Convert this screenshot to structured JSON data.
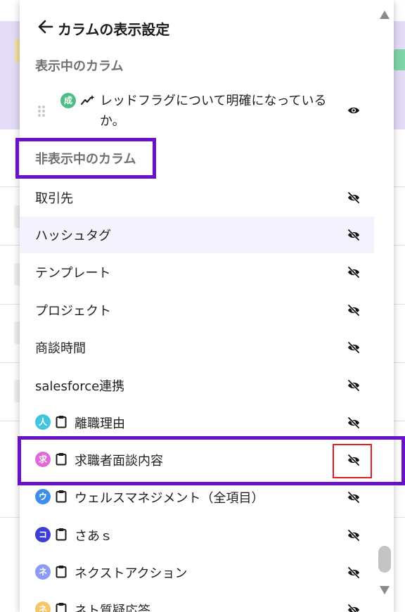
{
  "header": {
    "title": "カラムの表示設定"
  },
  "visible_section": {
    "label": "表示中のカラム",
    "items": [
      {
        "badge": "成",
        "badge_color": "#4dbd85",
        "text_line1": "レッドフラグについて明確になっている",
        "text_line2": "か。"
      }
    ]
  },
  "hidden_section": {
    "label": "非表示中のカラム",
    "items": [
      {
        "label": "取引先"
      },
      {
        "label": "ハッシュタグ"
      },
      {
        "label": "テンプレート"
      },
      {
        "label": "プロジェクト"
      },
      {
        "label": "商談時間"
      },
      {
        "label": "salesforce連携"
      },
      {
        "label": "離職理由",
        "badge": "人",
        "badge_color": "#42c6e0"
      },
      {
        "label": "求職者面談内容",
        "badge": "求",
        "badge_color": "#e168d8"
      },
      {
        "label": "ウェルスマネジメント（全項目）",
        "badge": "ウ",
        "badge_color": "#3f8ee9"
      },
      {
        "label": "さあｓ",
        "badge": "コ",
        "badge_color": "#3d3ed4"
      },
      {
        "label": "ネクストアクション",
        "badge": "ネ",
        "badge_color": "#8a9cf3"
      },
      {
        "label": "ネト質疑応答",
        "badge": "ネ",
        "badge_color": "#f6c567"
      }
    ]
  },
  "icons": {
    "back": "arrow-left-icon",
    "visible": "eye-icon",
    "hidden": "eye-off-icon",
    "clipboard": "clipboard-icon",
    "sparkle": "sparkle-chart-icon",
    "drag": "drag-handle-icon"
  },
  "colors": {
    "annotation_purple": "#6811c8",
    "annotation_red": "#e11d1d",
    "background_band": "#e4dcf7",
    "row_highlight": "#f4f2fd"
  }
}
